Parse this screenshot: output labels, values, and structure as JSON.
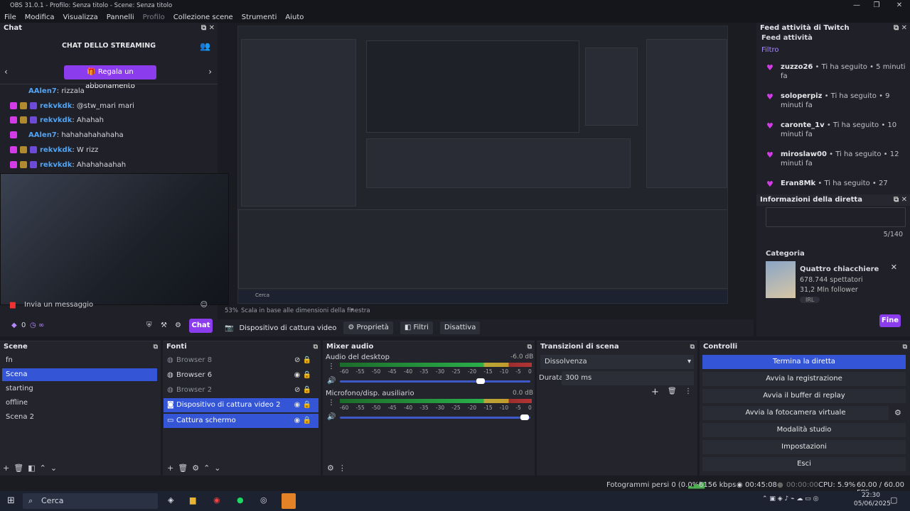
{
  "window": {
    "title": "OBS 31.0.1 - Profilo: Senza titolo - Scene: Senza titolo"
  },
  "menu": [
    "File",
    "Modifica",
    "Visualizza",
    "Pannelli",
    "Profilo",
    "Collezione scene",
    "Strumenti",
    "Aiuto"
  ],
  "chat": {
    "dock_title": "Chat",
    "header": "CHAT DELLO STREAMING",
    "sub_button": "Regala un abbonamento",
    "messages": [
      {
        "user": "AAlen7",
        "text": ": rizzala"
      },
      {
        "user": "rekvkdk",
        "text": ": @stw_mari mari"
      },
      {
        "user": "rekvkdk",
        "text": ": Ahahah"
      },
      {
        "user": "AAlen7",
        "text": ": hahahahahahaha"
      },
      {
        "user": "rekvkdk",
        "text": ": W rizz"
      },
      {
        "user": "rekvkdk",
        "text": ": Ahahahaahah"
      }
    ],
    "input_placeholder": "Invia un messaggio",
    "points": "0",
    "chat_button": "Chat"
  },
  "preview": {
    "scale_text": "Scala in base alle dimensioni della finestra",
    "zoom": "53%",
    "nested_search": "Cerca"
  },
  "source_bar": {
    "selected_source": "Dispositivo di cattura video",
    "props": "Proprietà",
    "filters": "Filtri",
    "deactivate": "Disattiva"
  },
  "twitch": {
    "dock_title": "Feed attività di Twitch",
    "subtitle": "Feed attività",
    "filter": "Filtro",
    "items": [
      {
        "name": "zuzzo26",
        "action": " • Ti ha seguito • 5 minuti fa"
      },
      {
        "name": "soloperpiz",
        "action": " • Ti ha seguito • 9 minuti fa"
      },
      {
        "name": "caronte_1v",
        "action": " • Ti ha seguito • 10 minuti fa"
      },
      {
        "name": "miroslaw00",
        "action": " • Ti ha seguito • 12 minuti fa"
      },
      {
        "name": "Eran8Mk",
        "action": " • Ti ha seguito • 27"
      }
    ]
  },
  "info": {
    "dock_title": "Informazioni della diretta",
    "char_count": "5/140",
    "category_label": "Categoria",
    "category_name": "Quattro chiacchiere",
    "viewers": "678.744 spettatori",
    "followers": "31,2 Mln follower",
    "tag": "IRL",
    "fine": "Fine"
  },
  "scenes": {
    "title": "Scene",
    "items": [
      "fn",
      "Scena",
      "starting",
      "offline",
      "Scena 2"
    ],
    "selected": 1
  },
  "sources": {
    "title": "Fonti",
    "items": [
      "Browser 8",
      "Browser 6",
      "Browser 2",
      "Dispositivo di cattura video 2",
      "Cattura schermo"
    ]
  },
  "mixer": {
    "title": "Mixer audio",
    "channels": [
      {
        "name": "Audio del desktop",
        "db": "-6.0 dB",
        "level": 0.74
      },
      {
        "name": "Microfono/disp. ausiliario",
        "db": "0.0 dB",
        "level": 0.97
      }
    ],
    "scale": [
      "-60",
      "-55",
      "-50",
      "-45",
      "-40",
      "-35",
      "-30",
      "-25",
      "-20",
      "-15",
      "-10",
      "-5",
      "0"
    ]
  },
  "transitions": {
    "title": "Transizioni di scena",
    "selected": "Dissolvenza",
    "duration_label": "Durata",
    "duration": "300 ms"
  },
  "controls": {
    "title": "Controlli",
    "buttons": [
      "Termina la diretta",
      "Avvia la registrazione",
      "Avvia il buffer di replay",
      "Avvia la fotocamera virtuale",
      "Modalità studio",
      "Impostazioni",
      "Esci"
    ]
  },
  "status": {
    "dropped": "Fotogrammi persi 0 (0.0%)",
    "bitrate": "6156 kbps",
    "live_time": "00:45:08",
    "rec_time": "00:00:00",
    "cpu": "CPU: 5.9%",
    "fps": "60.00 / 60.00 FPS"
  },
  "taskbar": {
    "search": "Cerca",
    "time": "22:30",
    "date": "05/06/2025"
  },
  "colors": {
    "accent": "#3355d6",
    "twitch": "#8b3ded",
    "heart": "#d33be6"
  }
}
